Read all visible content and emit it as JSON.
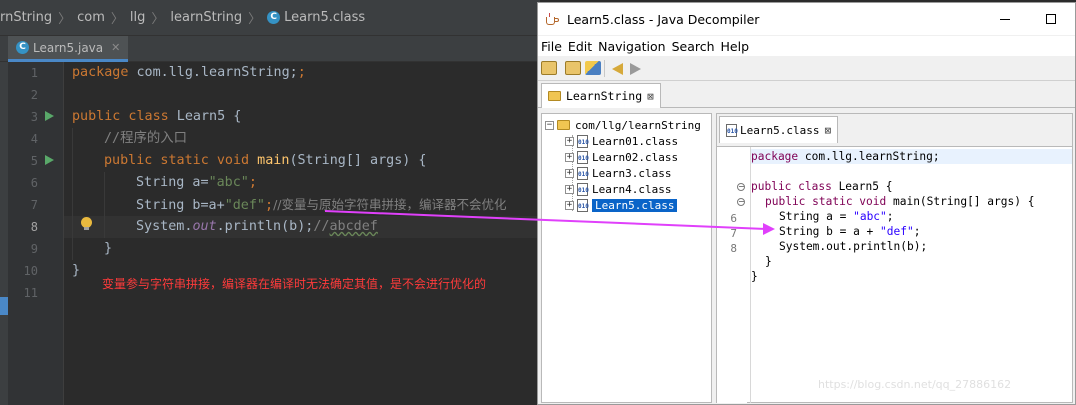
{
  "ide": {
    "breadcrumbs": [
      "arnString",
      "com",
      "llg",
      "learnString",
      "Learn5.class"
    ],
    "file_icon_letter": "C",
    "tab_label": "Learn5.java",
    "line_numbers": [
      "1",
      "2",
      "3",
      "4",
      "5",
      "6",
      "7",
      "8",
      "9",
      "10",
      "11"
    ],
    "code": {
      "l1_kw": "package",
      "l1_rest": " com.llg.learnString;",
      "l3_kw": "public class",
      "l3_rest": " Learn5 {",
      "l4_comment": "//程序的入口",
      "l5_kw": "public static void",
      "l5_fn": " main",
      "l5_rest": "(String[] args) {",
      "l6_a": "String a=",
      "l6_str": "\"abc\"",
      "l6_end": ";",
      "l7_a": "String b=a+",
      "l7_str": "\"def\"",
      "l7_end": ";",
      "l7_comment": "//变量与原始字符串拼接，编译器不会优化",
      "l8_a": "System.",
      "l8_field": "out",
      "l8_b": ".println(b);",
      "l8_comment_a": "//",
      "l8_comment_b": "abcdef",
      "l9": "}",
      "l10": "}"
    },
    "annotation": "变量参与字符串拼接，编译器在编译时无法确定其值，是不会进行优化的",
    "colors": {
      "annotation": "#ff3b3b",
      "arrow": "#e040fb"
    }
  },
  "decompiler": {
    "title": "Learn5.class - Java Decompiler",
    "menu": [
      "File",
      "Edit",
      "Navigation",
      "Search",
      "Help"
    ],
    "outer_tab": "LearnString",
    "tree": {
      "root": "com/llg/learnString",
      "class_icon_text": "010",
      "items": [
        "Learn01.class",
        "Learn02.class",
        "Learn3.class",
        "Learn4.class",
        "Learn5.class"
      ],
      "selected": "Learn5.class"
    },
    "inner_tab": "Learn5.class",
    "source": {
      "l1_kw": "package",
      "l1_rest": " com.llg.learnString;",
      "l2_kw": "public class",
      "l2_rest": " Learn5 {",
      "l3_kw": "public static void",
      "l3_rest": " main(String[] args) {",
      "l4_a": "String a = ",
      "l4_str": "\"abc\"",
      "l4_end": ";",
      "l5_a": "String b = a + ",
      "l5_str": "\"def\"",
      "l5_end": ";",
      "l6": "System.out.println(b);",
      "l7": "}",
      "l8": "}"
    },
    "gutter_numbers": [
      "6",
      "7",
      "8"
    ],
    "watermark": "https://blog.csdn.net/qq_27886162"
  }
}
